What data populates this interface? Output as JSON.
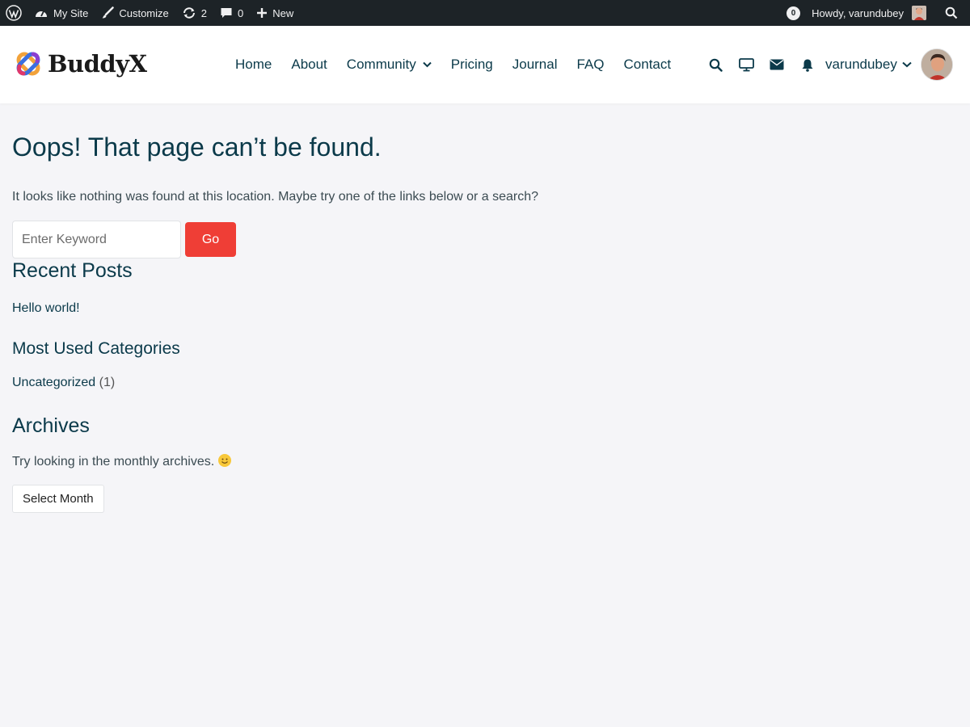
{
  "adminbar": {
    "my_site": "My Site",
    "customize": "Customize",
    "updates_count": "2",
    "comments_count": "0",
    "new_label": "New",
    "notifications_count": "0",
    "howdy": "Howdy, varundubey",
    "bg_color": "#1d2327"
  },
  "header": {
    "logo_text": "BuddyX",
    "nav": [
      {
        "label": "Home"
      },
      {
        "label": "About"
      },
      {
        "label": "Community"
      },
      {
        "label": "Pricing"
      },
      {
        "label": "Journal"
      },
      {
        "label": "FAQ"
      },
      {
        "label": "Contact"
      }
    ],
    "username": "varundubey",
    "icons": [
      "search-icon",
      "desktop-icon",
      "envelope-icon",
      "bell-icon",
      "chevron-down-icon"
    ]
  },
  "page": {
    "title": "Oops! That page can’t be found.",
    "intro": "It looks like nothing was found at this location. Maybe try one of the links below or a search?",
    "search_placeholder": "Enter Keyword",
    "search_button": "Go",
    "accent_color": "#ef3e36"
  },
  "widgets": {
    "recent_posts_title": "Recent Posts",
    "recent_posts": [
      "Hello world!"
    ],
    "categories_title": "Most Used Categories",
    "category": "Uncategorized",
    "category_count": "(1)",
    "archives_title": "Archives",
    "archives_text": "Try looking in the monthly archives.",
    "select_month": "Select Month"
  }
}
